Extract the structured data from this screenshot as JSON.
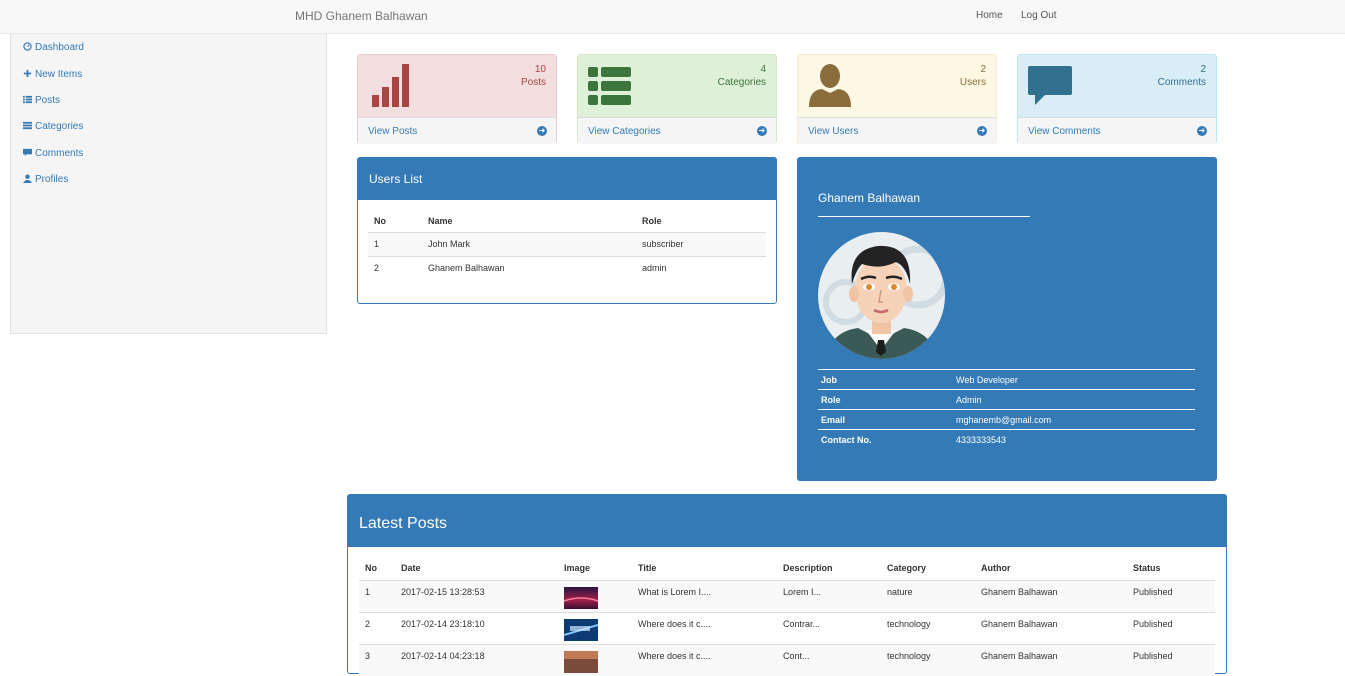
{
  "navbar": {
    "brand": "MHD Ghanem Balhawan",
    "home": "Home",
    "logout": "Log Out"
  },
  "sidebar": {
    "items": [
      {
        "label": "Dashboard",
        "icon": "dashboard-icon"
      },
      {
        "label": "New Items",
        "icon": "plus-icon"
      },
      {
        "label": "Posts",
        "icon": "list-icon"
      },
      {
        "label": "Categories",
        "icon": "categories-icon"
      },
      {
        "label": "Comments",
        "icon": "comment-icon"
      },
      {
        "label": "Profiles",
        "icon": "user-icon"
      }
    ]
  },
  "stats": [
    {
      "count": "10",
      "label": "Posts",
      "link": "View Posts",
      "icon": "bar-chart-icon",
      "color": "#a94442"
    },
    {
      "count": "4",
      "label": "Categories",
      "link": "View Categories",
      "icon": "th-list-icon",
      "color": "#3c763d"
    },
    {
      "count": "2",
      "label": "Users",
      "link": "View Users",
      "icon": "user-icon",
      "color": "#8a6d3b"
    },
    {
      "count": "2",
      "label": "Comments",
      "link": "View Comments",
      "icon": "comment-icon",
      "color": "#31708f"
    }
  ],
  "users_list": {
    "title": "Users List",
    "columns": [
      "No",
      "Name",
      "Role"
    ],
    "rows": [
      [
        "1",
        "John Mark",
        "subscriber"
      ],
      [
        "2",
        "Ghanem Balhawan",
        "admin"
      ]
    ]
  },
  "profile": {
    "name": "Ghanem Balhawan",
    "fields": [
      {
        "key": "Job",
        "value": "Web Developer"
      },
      {
        "key": "Role",
        "value": "Admin"
      },
      {
        "key": "Email",
        "value": "mghanemb@gmail.com"
      },
      {
        "key": "Contact No.",
        "value": "4333333543"
      }
    ]
  },
  "latest_posts": {
    "title": "Latest Posts",
    "columns": [
      "No",
      "Date",
      "Image",
      "Title",
      "Description",
      "Category",
      "Author",
      "Status"
    ],
    "rows": [
      [
        "1",
        "2017-02-15 13:28:53",
        "",
        "What is Lorem I....",
        "Lorem I...",
        "nature",
        "Ghanem Balhawan",
        "Published"
      ],
      [
        "2",
        "2017-02-14 23:18:10",
        "",
        "Where does it c....",
        "Contrar...",
        "technology",
        "Ghanem Balhawan",
        "Published"
      ],
      [
        "3",
        "2017-02-14 04:23:18",
        "",
        "Where does it c....",
        "Cont...",
        "technology",
        "Ghanem Balhawan",
        "Published"
      ]
    ]
  },
  "colors": {
    "primary": "#337ab7",
    "danger_bg": "#f2dede",
    "success_bg": "#dff0d8",
    "warning_bg": "#fcf8e3",
    "info_bg": "#d9edf7"
  }
}
